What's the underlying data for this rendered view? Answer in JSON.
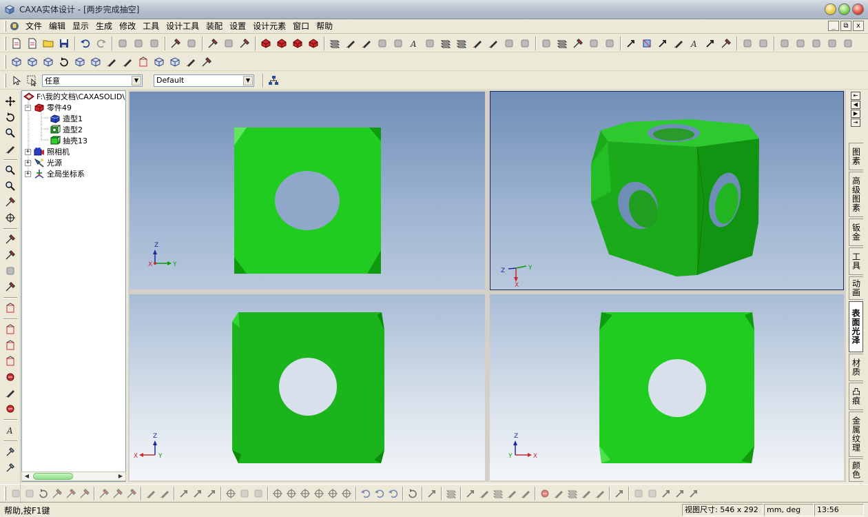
{
  "window": {
    "title": "CAXA实体设计 - [两步完成抽空]"
  },
  "menu": {
    "items": [
      "文件",
      "编辑",
      "显示",
      "生成",
      "修改",
      "工具",
      "设计工具",
      "装配",
      "设置",
      "设计元素",
      "窗口",
      "帮助"
    ],
    "mdi_buttons": [
      "_",
      "⧉",
      "x"
    ]
  },
  "selectors": {
    "filter_value": "任意",
    "style_value": "Default"
  },
  "tree": {
    "root": "F:\\我的文档\\CAXASOLID\\",
    "part": "零件49",
    "children": [
      "造型1",
      "造型2",
      "抽壳13"
    ],
    "camera": "照相机",
    "lights": "光源",
    "global_coords": "全局坐标系"
  },
  "axes": {
    "x": "X",
    "y": "Y",
    "z": "Z"
  },
  "right_tabs": [
    "图素",
    "高级图素",
    "钣金",
    "工具",
    "动画",
    "表面光泽",
    "材质",
    "凸痕",
    "金属纹理",
    "颜色"
  ],
  "right_tabs_active": "表面光泽",
  "status": {
    "help": "帮助,按F1键",
    "view_size_label": "视图尺寸: 546 x 292",
    "units": "mm, deg",
    "time": "13:56"
  },
  "colors": {
    "model_green": "#1fcc1f",
    "model_dark_green": "#0f9a0f",
    "viewport_sky": "#6f8eb7",
    "active_viewport_border": "#1e2a5a"
  },
  "toolbar_icons": {
    "row1": [
      "new-part-icon",
      "new-drawing-icon",
      "open-icon",
      "save-icon",
      "undo-icon",
      "redo-icon",
      "rotate-icon",
      "pan-icon",
      "camera-icon",
      "measure-icon",
      "help-pointer-icon",
      "lights-icon",
      "scene-icon",
      "render-icon",
      "extrude-icon",
      "revolve-icon",
      "sweep-icon",
      "loft-icon",
      "text-icon",
      "section-icon",
      "shell-icon",
      "blend-icon",
      "chamfer-icon"
    ],
    "row2": [
      "box-icon",
      "cylinder-icon",
      "cone-icon",
      "sphere-icon",
      "torus-icon",
      "wedge-icon",
      "spline-icon",
      "curve-icon",
      "mirror-icon",
      "pattern-icon",
      "scale-icon",
      "align-icon",
      "smart-snap-icon"
    ]
  }
}
